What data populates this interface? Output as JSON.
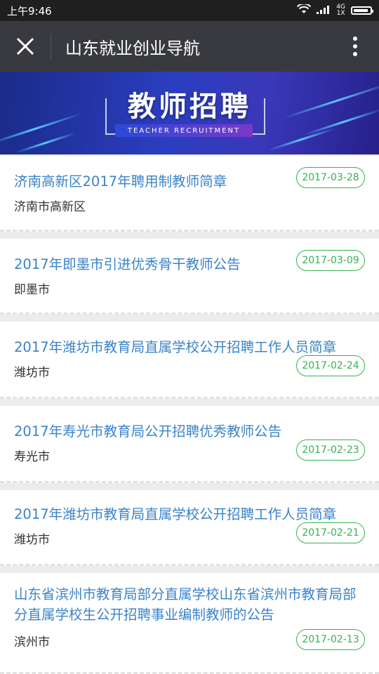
{
  "status_bar": {
    "time": "上午9:46",
    "network_top": "4G",
    "network_bottom": "1X"
  },
  "nav": {
    "title": "山东就业创业导航"
  },
  "banner": {
    "title": "教师招聘",
    "subtitle": "TEACHER RECRUITMENT"
  },
  "items": [
    {
      "title": "济南高新区2017年聘用制教师简章",
      "location": "济南市高新区",
      "date": "2017-03-28"
    },
    {
      "title": "2017年即墨市引进优秀骨干教师公告",
      "location": "即墨市",
      "date": "2017-03-09"
    },
    {
      "title": "2017年潍坊市教育局直属学校公开招聘工作人员简章",
      "location": "潍坊市",
      "date": "2017-02-24"
    },
    {
      "title": "2017年寿光市教育局公开招聘优秀教师公告",
      "location": "寿光市",
      "date": "2017-02-23"
    },
    {
      "title": "2017年潍坊市教育局直属学校公开招聘工作人员简章",
      "location": "潍坊市",
      "date": "2017-02-21"
    },
    {
      "title": "山东省滨州市教育局部分直属学校山东省滨州市教育局部分直属学校生公开招聘事业编制教师的公告",
      "location": "滨州市",
      "date": "2017-02-13"
    }
  ]
}
